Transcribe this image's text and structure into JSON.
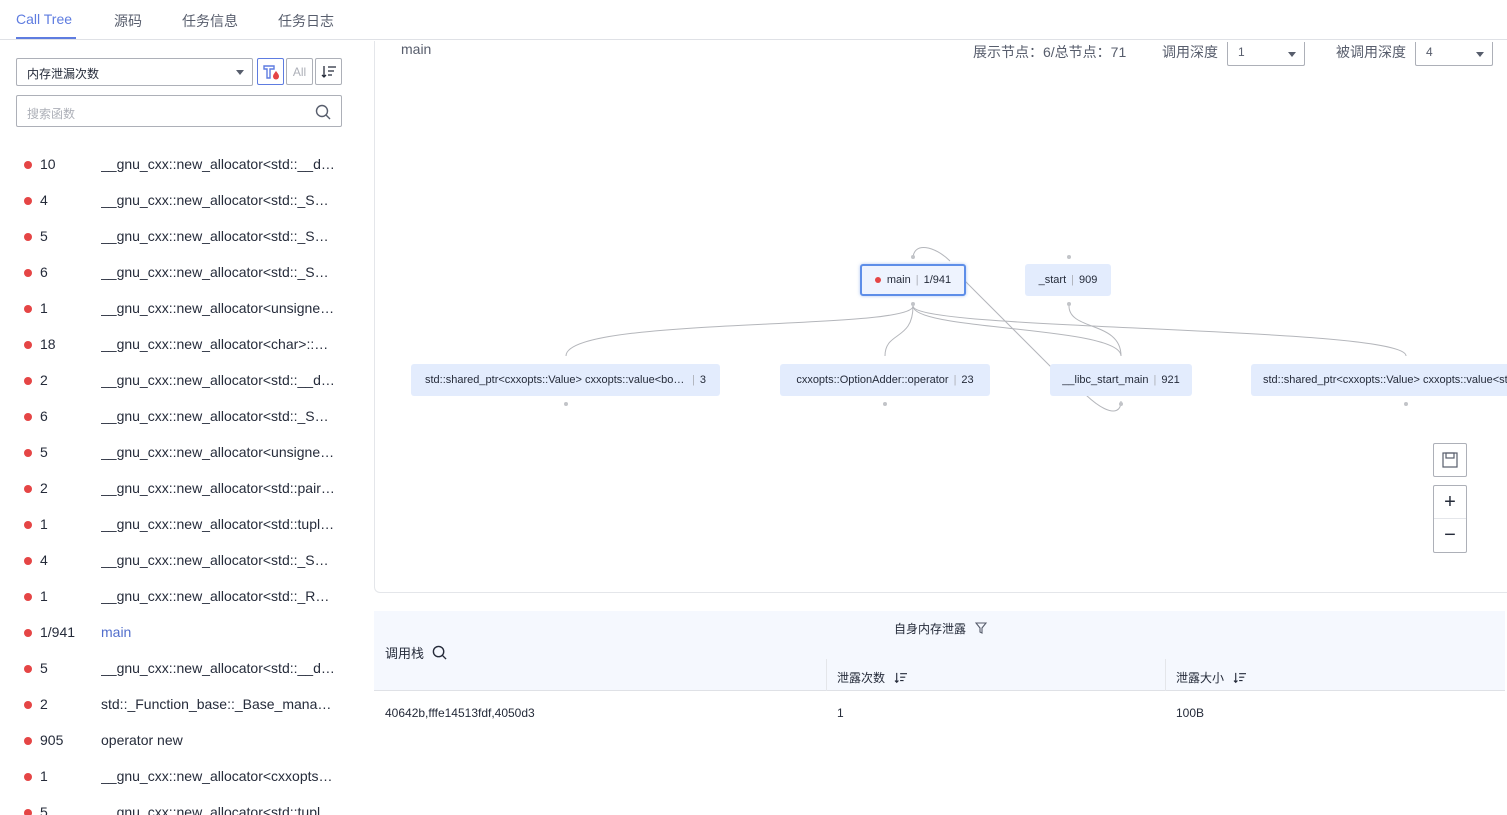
{
  "tabs": [
    {
      "label": "Call Tree",
      "active": true
    },
    {
      "label": "源码",
      "active": false
    },
    {
      "label": "任务信息",
      "active": false
    },
    {
      "label": "任务日志",
      "active": false
    }
  ],
  "sidebar": {
    "metric_select": "内存泄漏次数",
    "all_label": "All",
    "search_placeholder": "搜索函数",
    "items": [
      {
        "count": "10",
        "name": "__gnu_cxx::new_allocator<std::__detail::_Hash_node<std::pair<..."
      },
      {
        "count": "4",
        "name": "__gnu_cxx::new_allocator<std::_Sp_counted_ptr_inplace<..."
      },
      {
        "count": "5",
        "name": "__gnu_cxx::new_allocator<std::_Sp_counted_ptr_inplace<..."
      },
      {
        "count": "6",
        "name": "__gnu_cxx::new_allocator<std::_Sp_counted_ptr_inplace<..."
      },
      {
        "count": "1",
        "name": "__gnu_cxx::new_allocator<unsigned long>::allocate"
      },
      {
        "count": "18",
        "name": "__gnu_cxx::new_allocator<char>::allocate"
      },
      {
        "count": "2",
        "name": "__gnu_cxx::new_allocator<std::__detail::_Hash_node_base*>..."
      },
      {
        "count": "6",
        "name": "__gnu_cxx::new_allocator<std::_Sp_counted_ptr_inplace<..."
      },
      {
        "count": "5",
        "name": "__gnu_cxx::new_allocator<unsigned char>::allocate"
      },
      {
        "count": "2",
        "name": "__gnu_cxx::new_allocator<std::pair<std::string const, ..."
      },
      {
        "count": "1",
        "name": "__gnu_cxx::new_allocator<std::tuple<std::string, ..."
      },
      {
        "count": "4",
        "name": "__gnu_cxx::new_allocator<std::_Sp_counted_ptr_inplace<..."
      },
      {
        "count": "1",
        "name": "__gnu_cxx::new_allocator<std::_Rb_tree_node<..."
      },
      {
        "count": "1/941",
        "name": "main",
        "link": true
      },
      {
        "count": "5",
        "name": "__gnu_cxx::new_allocator<std::__detail::_Hash_node<..."
      },
      {
        "count": "2",
        "name": "std::_Function_base::_Base_manager<..."
      },
      {
        "count": "905",
        "name": "operator new"
      },
      {
        "count": "1",
        "name": "__gnu_cxx::new_allocator<cxxopts::KeyValue>::allocate"
      },
      {
        "count": "5",
        "name": "__gnu_cxx::new_allocator<std::tuple<..."
      }
    ]
  },
  "graph": {
    "title": "main",
    "stats": "展示节点：6/总节点：71",
    "caller_depth_label": "调用深度",
    "caller_depth_value": "1",
    "callee_depth_label": "被调用深度",
    "callee_depth_value": "4",
    "nodes": {
      "main": {
        "label": "main",
        "value": "1/941"
      },
      "start": {
        "label": "_start",
        "value": "909"
      },
      "shared_ptr_1": {
        "label": "std::shared_ptr<cxxopts::Value> cxxopts::value<bool>",
        "value": "3"
      },
      "option_adder": {
        "label": "cxxopts::OptionAdder::operator",
        "value": "23"
      },
      "libc_start_main": {
        "label": "__libc_start_main",
        "value": "921"
      },
      "shared_ptr_2": {
        "label": "std::shared_ptr<cxxopts::Value> cxxopts::value<std::string>",
        "value": ""
      }
    },
    "zoom_in": "+",
    "zoom_out": "−"
  },
  "table": {
    "group_header": "自身内存泄露",
    "col_stack": "调用栈",
    "col_count": "泄露次数",
    "col_size": "泄露大小",
    "rows": [
      {
        "stack": "40642b,fffe14513fdf,4050d3",
        "count": "1",
        "size": "100B"
      }
    ]
  }
}
